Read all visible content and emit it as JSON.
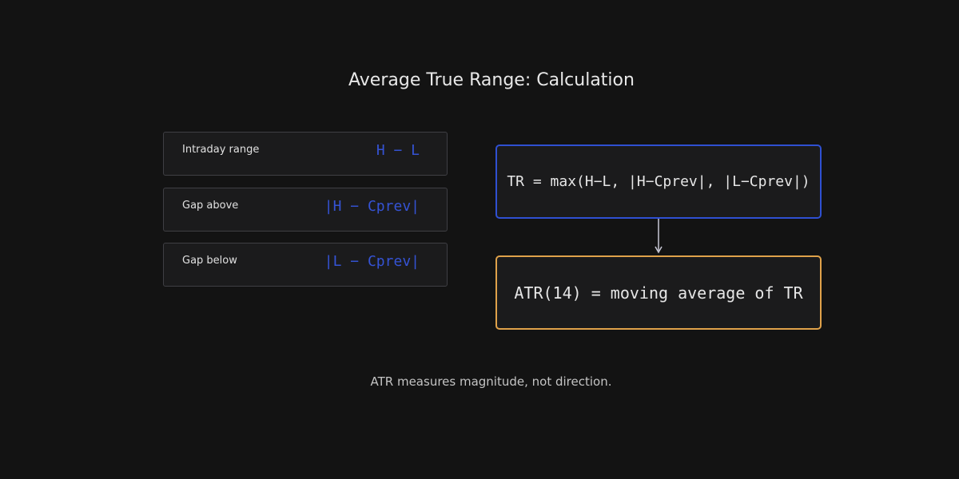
{
  "title": "Average True Range: Calculation",
  "components": [
    {
      "label": "Intraday range",
      "formula": "H − L"
    },
    {
      "label": "Gap above",
      "formula": "|H − Cprev|"
    },
    {
      "label": "Gap below",
      "formula": "|L − Cprev|"
    }
  ],
  "true_range_box": {
    "text": "TR = max(H−L, |H−Cprev|, |L−Cprev|)",
    "border_color": "#2f50d2"
  },
  "atr_box": {
    "text": "ATR(14) = moving average of TR",
    "border_color": "#e0a24a"
  },
  "formula_color": "#3553d4",
  "note": "ATR measures magnitude, not direction."
}
